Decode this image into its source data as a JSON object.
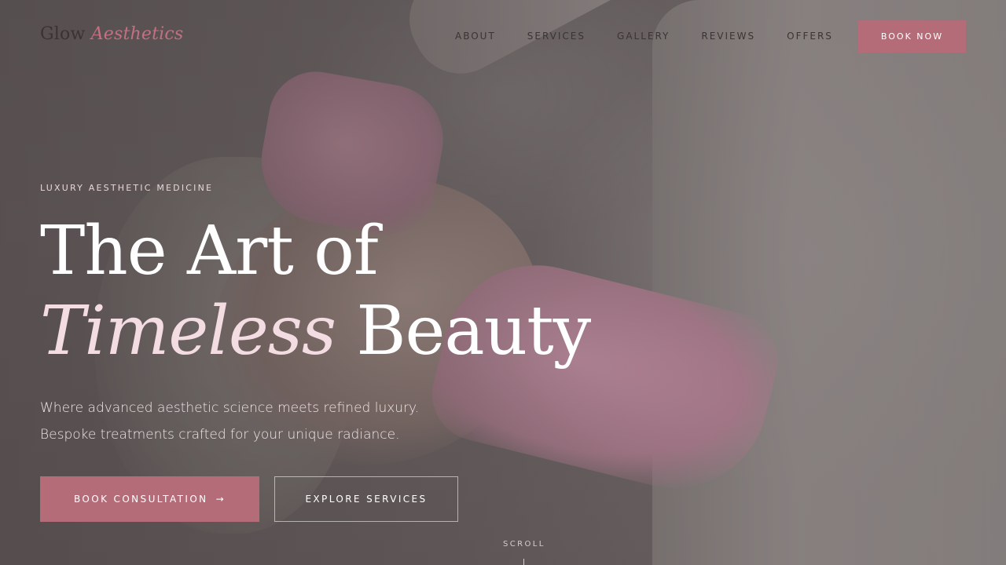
{
  "brand": {
    "name_plain": "Glow",
    "name_accent": "Aesthetics"
  },
  "nav": {
    "links": [
      "ABOUT",
      "SERVICES",
      "GALLERY",
      "REVIEWS",
      "OFFERS"
    ],
    "cta": "BOOK NOW"
  },
  "hero": {
    "eyebrow": "LUXURY AESTHETIC MEDICINE",
    "headline_line1": "The Art of",
    "headline_italic": "Timeless",
    "headline_word": "Beauty",
    "subcopy_line1": "Where advanced aesthetic science meets refined luxury.",
    "subcopy_line2": "Bespoke treatments crafted for your unique radiance.",
    "primary_button": "BOOK CONSULTATION",
    "primary_button_icon": "→",
    "secondary_button": "EXPLORE SERVICES",
    "scroll_label": "SCROLL"
  },
  "colors": {
    "accent": "#b46c79",
    "logo_accent": "#c56f83",
    "text_dark": "#3b3434"
  }
}
